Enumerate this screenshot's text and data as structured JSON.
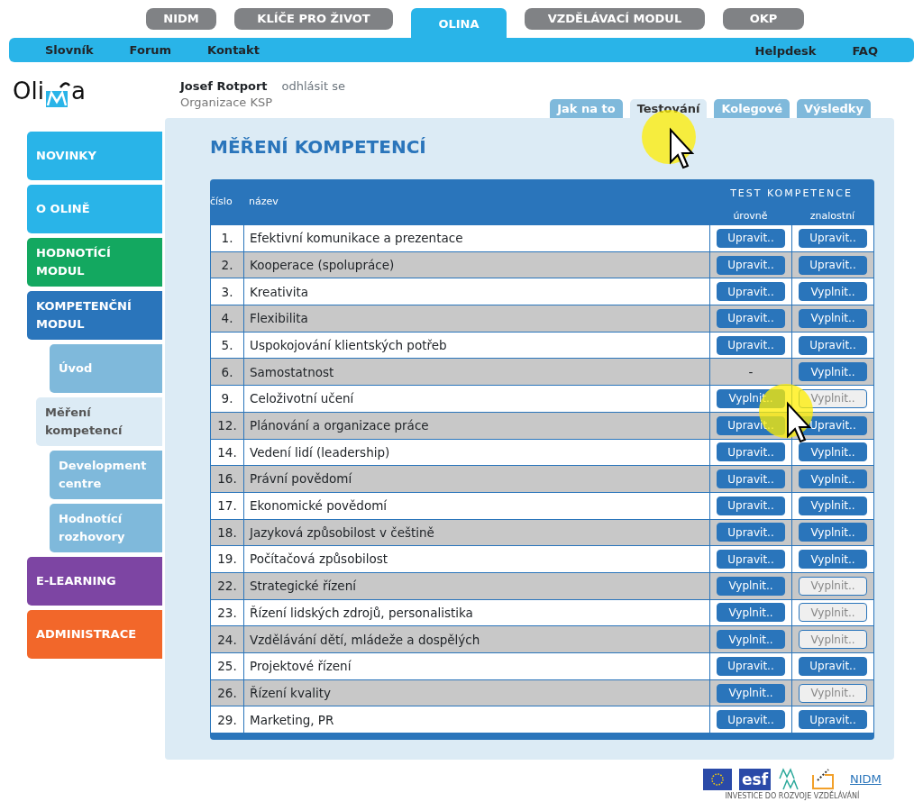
{
  "top_tabs": [
    {
      "label": "NIDM",
      "selected": false
    },
    {
      "label": "KLÍČE PRO ŽIVOT",
      "selected": false
    },
    {
      "label": "OLINA",
      "selected": true
    },
    {
      "label": "VZDĚLÁVACÍ MODUL",
      "selected": false
    },
    {
      "label": "OKP",
      "selected": false
    }
  ],
  "nav_left": [
    "Slovník",
    "Forum",
    "Kontakt"
  ],
  "nav_right": [
    "Helpdesk",
    "FAQ"
  ],
  "logo": {
    "before": "Oli",
    "after": "a"
  },
  "user": {
    "name": "Josef Rotport",
    "logout": "odhlásit se",
    "organization": "Organizace KSP"
  },
  "sub_tabs": [
    {
      "label": "Jak na to",
      "selected": false
    },
    {
      "label": "Testování",
      "selected": true
    },
    {
      "label": "Kolegové",
      "selected": false
    },
    {
      "label": "Výsledky",
      "selected": false
    }
  ],
  "sidebar": {
    "items": [
      {
        "label": "NOVINKY",
        "color": "#29b4e8",
        "selected": false
      },
      {
        "label": "O OLINĚ",
        "color": "#29b4e8",
        "selected": false
      },
      {
        "label": "HODNOTÍCÍ MODUL",
        "color": "#13a860",
        "selected": false
      },
      {
        "label": "KOMPETENČNÍ MODUL",
        "color": "#2a75bb",
        "selected": false,
        "children": [
          {
            "label": "Úvod",
            "color": "#7fb9db",
            "selected": false
          },
          {
            "label": "Měření kompetencí",
            "color": "#dcebf5",
            "selected": true
          },
          {
            "label": "Development centre",
            "color": "#7fb9db",
            "selected": false
          },
          {
            "label": "Hodnotící rozhovory",
            "color": "#7fb9db",
            "selected": false
          }
        ]
      },
      {
        "label": "E-LEARNING",
        "color": "#7d45a3",
        "selected": false
      },
      {
        "label": "ADMINISTRACE",
        "color": "#f2672a",
        "selected": false
      }
    ]
  },
  "page_title": "MĚŘENÍ KOMPETENCÍ",
  "table": {
    "columns": [
      "číslo",
      "název"
    ],
    "group_header": "TEST KOMPETENCE",
    "subcolumns": [
      "úrovně",
      "znalostní"
    ],
    "rows": [
      {
        "number": "1.",
        "name": "Efektivní komunikace a prezentace",
        "cells": [
          {
            "kind": "button",
            "label": "Upravit..",
            "disabled": false
          },
          {
            "kind": "button",
            "label": "Upravit..",
            "disabled": false
          }
        ]
      },
      {
        "number": "2.",
        "name": "Kooperace (spolupráce)",
        "cells": [
          {
            "kind": "button",
            "label": "Upravit..",
            "disabled": false
          },
          {
            "kind": "button",
            "label": "Upravit..",
            "disabled": false
          }
        ]
      },
      {
        "number": "3.",
        "name": "Kreativita",
        "cells": [
          {
            "kind": "button",
            "label": "Upravit..",
            "disabled": false
          },
          {
            "kind": "button",
            "label": "Vyplnit..",
            "disabled": false
          }
        ]
      },
      {
        "number": "4.",
        "name": "Flexibilita",
        "cells": [
          {
            "kind": "button",
            "label": "Upravit..",
            "disabled": false
          },
          {
            "kind": "button",
            "label": "Vyplnit..",
            "disabled": false
          }
        ]
      },
      {
        "number": "5.",
        "name": "Uspokojování klientských potřeb",
        "cells": [
          {
            "kind": "button",
            "label": "Upravit..",
            "disabled": false
          },
          {
            "kind": "button",
            "label": "Upravit..",
            "disabled": false
          }
        ]
      },
      {
        "number": "6.",
        "name": "Samostatnost",
        "cells": [
          {
            "kind": "text",
            "label": "-"
          },
          {
            "kind": "button",
            "label": "Vyplnit..",
            "disabled": false
          }
        ]
      },
      {
        "number": "9.",
        "name": "Celoživotní učení",
        "cells": [
          {
            "kind": "button",
            "label": "Vyplnit..",
            "disabled": false
          },
          {
            "kind": "button",
            "label": "Vyplnit..",
            "disabled": true
          }
        ]
      },
      {
        "number": "12.",
        "name": "Plánování a organizace práce",
        "cells": [
          {
            "kind": "button",
            "label": "Upravit..",
            "disabled": false
          },
          {
            "kind": "button",
            "label": "Upravit..",
            "disabled": false
          }
        ]
      },
      {
        "number": "14.",
        "name": "Vedení lidí (leadership)",
        "cells": [
          {
            "kind": "button",
            "label": "Upravit..",
            "disabled": false
          },
          {
            "kind": "button",
            "label": "Vyplnit..",
            "disabled": false
          }
        ]
      },
      {
        "number": "16.",
        "name": "Právní povědomí",
        "cells": [
          {
            "kind": "button",
            "label": "Upravit..",
            "disabled": false
          },
          {
            "kind": "button",
            "label": "Vyplnit..",
            "disabled": false
          }
        ]
      },
      {
        "number": "17.",
        "name": "Ekonomické povědomí",
        "cells": [
          {
            "kind": "button",
            "label": "Upravit..",
            "disabled": false
          },
          {
            "kind": "button",
            "label": "Vyplnit..",
            "disabled": false
          }
        ]
      },
      {
        "number": "18.",
        "name": "Jazyková způsobilost v češtině",
        "cells": [
          {
            "kind": "button",
            "label": "Upravit..",
            "disabled": false
          },
          {
            "kind": "button",
            "label": "Vyplnit..",
            "disabled": false
          }
        ]
      },
      {
        "number": "19.",
        "name": "Počítačová způsobilost",
        "cells": [
          {
            "kind": "button",
            "label": "Upravit..",
            "disabled": false
          },
          {
            "kind": "button",
            "label": "Vyplnit..",
            "disabled": false
          }
        ]
      },
      {
        "number": "22.",
        "name": "Strategické řízení",
        "cells": [
          {
            "kind": "button",
            "label": "Vyplnit..",
            "disabled": false
          },
          {
            "kind": "button",
            "label": "Vyplnit..",
            "disabled": true
          }
        ]
      },
      {
        "number": "23.",
        "name": "Řízení lidských zdrojů, personalistika",
        "cells": [
          {
            "kind": "button",
            "label": "Vyplnit..",
            "disabled": false
          },
          {
            "kind": "button",
            "label": "Vyplnit..",
            "disabled": true
          }
        ]
      },
      {
        "number": "24.",
        "name": "Vzdělávání dětí, mládeže a dospělých",
        "cells": [
          {
            "kind": "button",
            "label": "Vyplnit..",
            "disabled": false
          },
          {
            "kind": "button",
            "label": "Vyplnit..",
            "disabled": true
          }
        ]
      },
      {
        "number": "25.",
        "name": "Projektové řízení",
        "cells": [
          {
            "kind": "button",
            "label": "Upravit..",
            "disabled": false
          },
          {
            "kind": "button",
            "label": "Upravit..",
            "disabled": false
          }
        ]
      },
      {
        "number": "26.",
        "name": "Řízení kvality",
        "cells": [
          {
            "kind": "button",
            "label": "Vyplnit..",
            "disabled": false
          },
          {
            "kind": "button",
            "label": "Vyplnit..",
            "disabled": true
          }
        ]
      },
      {
        "number": "29.",
        "name": "Marketing, PR",
        "cells": [
          {
            "kind": "button",
            "label": "Upravit..",
            "disabled": false
          },
          {
            "kind": "button",
            "label": "Upravit..",
            "disabled": false
          }
        ]
      }
    ]
  },
  "footer": {
    "logo_texts": [
      "esf",
      "NIDM"
    ],
    "caption": "INVESTICE DO ROZVOJE VZDĚLÁVÁNÍ"
  }
}
